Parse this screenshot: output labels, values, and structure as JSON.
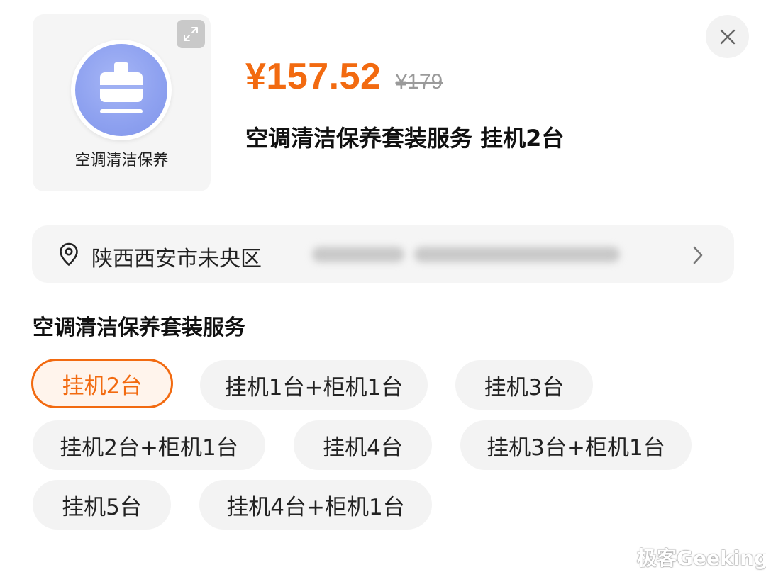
{
  "product": {
    "thumbnail_label": "空调清洁保养",
    "thumbnail_icon": "ac-cleaning-icon",
    "price": "¥157.52",
    "original_price": "¥179",
    "title": "空调清洁保养套装服务 挂机2台"
  },
  "address": {
    "icon": "location-pin-icon",
    "text": "陕西西安市未央区"
  },
  "options": {
    "section_title": "空调清洁保养套装服务",
    "items": [
      {
        "label": "挂机2台",
        "selected": true
      },
      {
        "label": "挂机1台+柜机1台",
        "selected": false
      },
      {
        "label": "挂机3台",
        "selected": false
      },
      {
        "label": "挂机2台+柜机1台",
        "selected": false
      },
      {
        "label": "挂机4台",
        "selected": false
      },
      {
        "label": "挂机3台+柜机1台",
        "selected": false
      },
      {
        "label": "挂机5台",
        "selected": false
      },
      {
        "label": "挂机4台+柜机1台",
        "selected": false
      }
    ]
  },
  "colors": {
    "accent": "#f26a10",
    "chip_bg": "#f3f3f3",
    "icon_circle": "#8fa2f0"
  },
  "watermark": "极客Geeking"
}
